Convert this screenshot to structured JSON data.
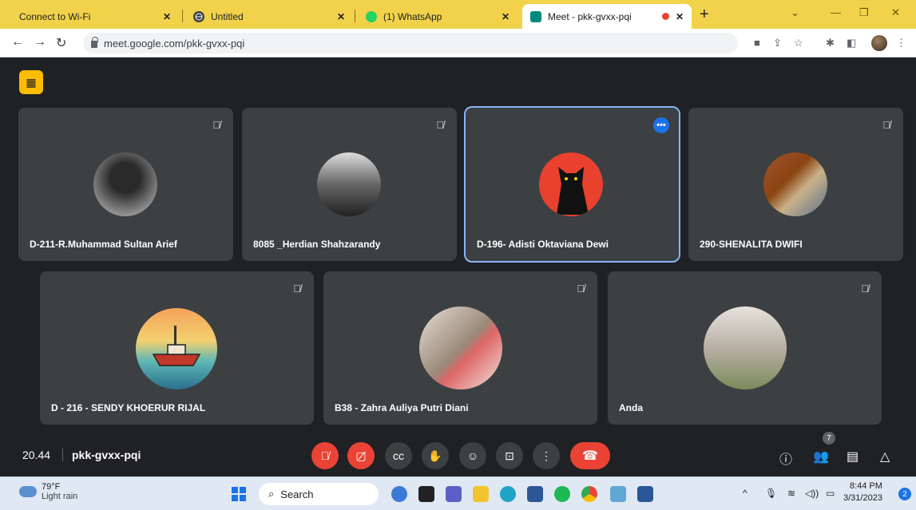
{
  "browser": {
    "tabs": [
      {
        "title": "Connect to Wi-Fi",
        "active": false
      },
      {
        "title": "Untitled",
        "active": false
      },
      {
        "title": "(1) WhatsApp",
        "active": false
      },
      {
        "title": "Meet - pkk-gvxx-pqi",
        "active": true
      }
    ],
    "url": "meet.google.com/pkk-gvxx-pqi"
  },
  "meet": {
    "participants": [
      {
        "name": "D-211-R.Muhammad Sultan Arief",
        "muted": true
      },
      {
        "name": "8085 _Herdian Shahzarandy",
        "muted": true
      },
      {
        "name": "D-196- Adisti Oktaviana Dewi",
        "muted": false,
        "speaking": true
      },
      {
        "name": "290-SHENALITA DWIFI",
        "muted": true
      },
      {
        "name": "D - 216 - SENDY KHOERUR RIJAL",
        "muted": true
      },
      {
        "name": "B38 - Zahra Auliya Putri Diani",
        "muted": true
      },
      {
        "name": "Anda",
        "muted": true
      }
    ],
    "time": "20.44",
    "meeting_code": "pkk-gvxx-pqi",
    "participant_count": "7",
    "more_dots": "•••"
  },
  "taskbar": {
    "weather_temp": "79°F",
    "weather_desc": "Light rain",
    "search_label": "Search",
    "clock_time": "8:44 PM",
    "clock_date": "3/31/2023",
    "notification_count": "2"
  },
  "colors": {
    "tab_strip": "#f2d24a",
    "meet_bg": "#202124",
    "tile_bg": "#3c4043",
    "danger": "#ea4335",
    "speaking_outline": "#8ab4f8"
  }
}
